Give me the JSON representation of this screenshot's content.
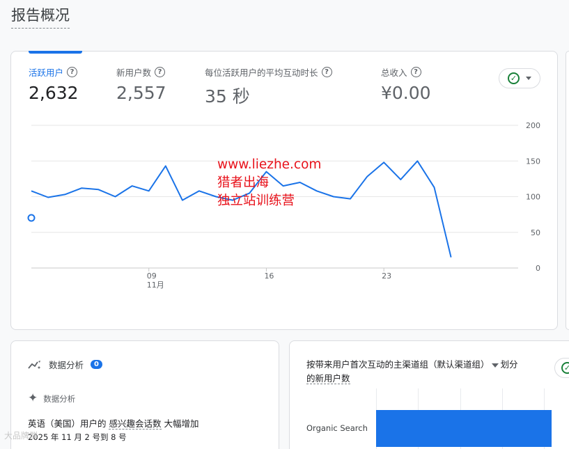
{
  "page": {
    "title": "报告概况"
  },
  "metrics": [
    {
      "label": "活跃用户",
      "value": "2,632",
      "active": true
    },
    {
      "label": "新用户数",
      "value": "2,557",
      "active": false
    },
    {
      "label": "每位活跃用户的平均互动时长",
      "value": "35 秒",
      "active": false
    },
    {
      "label": "总收入",
      "value": "¥0.00",
      "active": false
    }
  ],
  "help_glyph": "?",
  "compare": {
    "icon": "check-circle-icon",
    "check_glyph": "✓"
  },
  "watermark": {
    "line1": "www.liezhe.com",
    "line2": "猎者出海",
    "line3": "独立站训练营",
    "color": "#e8121b"
  },
  "chart_data": {
    "type": "line",
    "x": [
      "11-02",
      "11-03",
      "11-04",
      "11-05",
      "11-06",
      "11-07",
      "11-08",
      "11-09",
      "11-10",
      "11-11",
      "11-12",
      "11-13",
      "11-14",
      "11-15",
      "11-16",
      "11-17",
      "11-18",
      "11-19",
      "11-20",
      "11-21",
      "11-22",
      "11-23",
      "11-24",
      "11-25",
      "11-26",
      "11-27",
      "11-28",
      "11-29",
      "11-30",
      "12-01"
    ],
    "series": [
      {
        "values": [
          108,
          99,
          103,
          112,
          110,
          100,
          115,
          108,
          143,
          95,
          108,
          100,
          95,
          105,
          135,
          115,
          120,
          108,
          100,
          97,
          128,
          148,
          124,
          150,
          113,
          15
        ]
      }
    ],
    "x_ticks": [
      {
        "label": "09",
        "sub": "11月"
      },
      {
        "label": "16",
        "sub": ""
      },
      {
        "label": "23",
        "sub": ""
      }
    ],
    "y_ticks": [
      "200",
      "150",
      "100",
      "50",
      "0"
    ],
    "ylim": [
      0,
      200
    ],
    "grid": true,
    "color": "#1a73e8"
  },
  "insights": {
    "heading": "数据分析",
    "count": "0",
    "sub_heading": "数据分析",
    "title_prefix": "英语（美国）用户的 ",
    "title_metric": "感兴趣会话数",
    "title_suffix": " 大幅增加",
    "date": "2025 年 11 月 2 号到 8 号"
  },
  "channel_card": {
    "title_part1": "按带来用户首次互动的主渠道组（默认渠道组）",
    "title_part2": "划分",
    "title_part3": "的新用户数",
    "bar_label": "Organic Search",
    "bar_color": "#1a73e8"
  },
  "corner_watermark": "大品牌群"
}
